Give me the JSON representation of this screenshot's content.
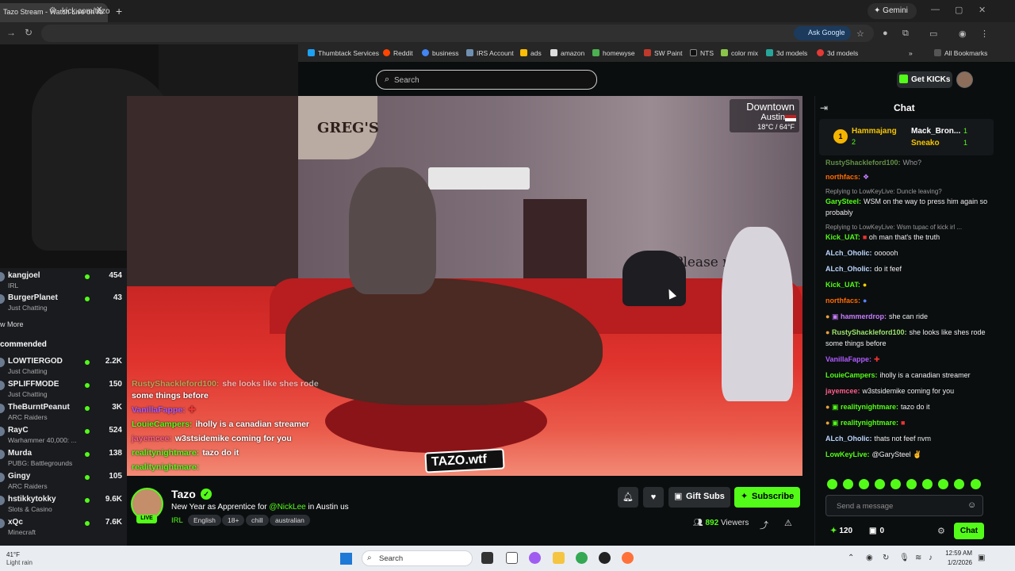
{
  "browser": {
    "tab_title": "Tazo Stream - Watch Live on Ki",
    "url": "kick.com/tazo",
    "gemini_label": "Gemini",
    "ask_google_label": "Ask Google",
    "bookmarks": [
      "Thumbtack Services",
      "Reddit",
      "business",
      "IRS Account",
      "ads",
      "amazon",
      "homewyse",
      "SW Paint",
      "NTS",
      "color mix",
      "3d models",
      "3d models"
    ],
    "all_bookmarks": "All Bookmarks"
  },
  "header": {
    "search_placeholder": "Search",
    "get_kicks_label": "Get KICKs"
  },
  "sidebar": {
    "following": [
      {
        "name": "kangjoel",
        "category": "IRL",
        "viewers": "454"
      },
      {
        "name": "BurgerPlanet",
        "category": "Just Chatting",
        "viewers": "43"
      }
    ],
    "show_more": "w More",
    "recommended_label": "commended",
    "recommended": [
      {
        "name": "LOWTIERGOD",
        "category": "Just Chatting",
        "viewers": "2.2K"
      },
      {
        "name": "SPLIFFMODE",
        "category": "Just Chatting",
        "viewers": "150"
      },
      {
        "name": "TheBurntPeanut",
        "category": "ARC Raiders",
        "viewers": "3K"
      },
      {
        "name": "RayC",
        "category": "Warhammer 40,000: ...",
        "viewers": "524"
      },
      {
        "name": "Murda",
        "category": "PUBG: Battlegrounds",
        "viewers": "138"
      },
      {
        "name": "Gingy",
        "category": "ARC Raiders",
        "viewers": "105"
      },
      {
        "name": "hstikkytokky",
        "category": "Slots & Casino",
        "viewers": "9.6K"
      },
      {
        "name": "xQc",
        "category": "Minecraft",
        "viewers": "7.6K"
      }
    ]
  },
  "video": {
    "weather_city": "Downtown",
    "weather_sub": "Austin",
    "weather_temp": "18°C / 64°F",
    "sign_text": "GREG'S",
    "please_text": "Please r",
    "logo_text": "TAZO.wtf",
    "overlay_chat": [
      {
        "user": "RustyShackleford100:",
        "text": "she looks like shes rode",
        "color": "#9be36a"
      },
      {
        "user": "",
        "text": "some things before",
        "color": "#ffffff"
      },
      {
        "user": "VanillaFappe:",
        "text": "",
        "color": "#b05cff"
      },
      {
        "user": "LouieCampers:",
        "text": "iholly is a canadian streamer",
        "color": "#53fc18"
      },
      {
        "user": "jayemcee:",
        "text": "w3stsidemike coming for you",
        "color": "#ff5c8a"
      },
      {
        "user": "realitynightmare:",
        "text": "tazo do it",
        "color": "#53fc18"
      },
      {
        "user": "realitynightmare:",
        "text": "",
        "color": "#53fc18"
      }
    ]
  },
  "stream": {
    "streamer": "Tazo",
    "live_label": "LIVE",
    "title_pre": "New Year as Apprentice for",
    "title_mention": "@NickLee",
    "title_post": "in Austin us",
    "category": "IRL",
    "tags": [
      "English",
      "18+",
      "chill",
      "australian"
    ],
    "gift_subs_label": "Gift Subs",
    "subscribe_label": "Subscribe",
    "viewers_count": "892",
    "viewers_label": "Viewers"
  },
  "chat": {
    "title": "Chat",
    "leaderboard": [
      {
        "rank": "1",
        "name": "Hammajang",
        "count": "2",
        "color": "#f5c400"
      },
      {
        "name": "Mack_Bron...",
        "count": "1",
        "color": "#ffffff"
      },
      {
        "name": "Sneako",
        "count": "1",
        "color": "#f5c400"
      }
    ],
    "messages": [
      {
        "reply": "",
        "user": "RustyShackleford100:",
        "text": "Who?",
        "color": "#9be36a"
      },
      {
        "reply": "",
        "user": "northfacs:",
        "text": "",
        "color": "#ff6a00"
      },
      {
        "reply": "Replying to LowKeyLive: Duncle leaving?",
        "user": "GarySteel:",
        "text": "WSM on the way to press him again so probably",
        "color": "#53fc18"
      },
      {
        "reply": "Replying to LowKeyLive: Wsm tupac of kick irl ...",
        "user": "Kick_UAT:",
        "text": "oh man that's the truth",
        "color": "#53fc18"
      },
      {
        "reply": "",
        "user": "ALch_Oholic:",
        "text": "oooooh",
        "color": "#bcd7ff"
      },
      {
        "reply": "",
        "user": "ALch_Oholic:",
        "text": "do it feef",
        "color": "#bcd7ff"
      },
      {
        "reply": "",
        "user": "Kick_UAT:",
        "text": "",
        "color": "#53fc18"
      },
      {
        "reply": "",
        "user": "northfacs:",
        "text": "",
        "color": "#ff6a00"
      },
      {
        "reply": "",
        "user": "hammerdrop:",
        "text": "she can ride",
        "color": "#c77dff"
      },
      {
        "reply": "",
        "user": "RustyShackleford100:",
        "text": "she looks like shes rode some things before",
        "color": "#9be36a"
      },
      {
        "reply": "",
        "user": "VanillaFappe:",
        "text": "",
        "color": "#b05cff"
      },
      {
        "reply": "",
        "user": "LouieCampers:",
        "text": "iholly is a canadian streamer",
        "color": "#53fc18"
      },
      {
        "reply": "",
        "user": "jayemcee:",
        "text": "w3stsidemike coming for you",
        "color": "#ff5c8a"
      },
      {
        "reply": "",
        "user": "realitynightmare:",
        "text": "tazo do it",
        "color": "#53fc18"
      },
      {
        "reply": "",
        "user": "realitynightmare:",
        "text": "",
        "color": "#53fc18"
      },
      {
        "reply": "",
        "user": "ALch_Oholic:",
        "text": "thats not feef nvm",
        "color": "#bcd7ff"
      },
      {
        "reply": "",
        "user": "LowKeyLive:",
        "text": "@GarySteel",
        "color": "#53fc18"
      }
    ],
    "send_placeholder": "Send a message",
    "kicks_count": "120",
    "box_count": "0",
    "chat_button": "Chat"
  },
  "taskbar": {
    "weather_temp": "41°F",
    "weather_desc": "Light rain",
    "search_label": "Search",
    "time": "12:59 AM",
    "date": "1/2/2026"
  },
  "colors": {
    "accent": "#53fc18",
    "background": "#0b0e0f"
  }
}
